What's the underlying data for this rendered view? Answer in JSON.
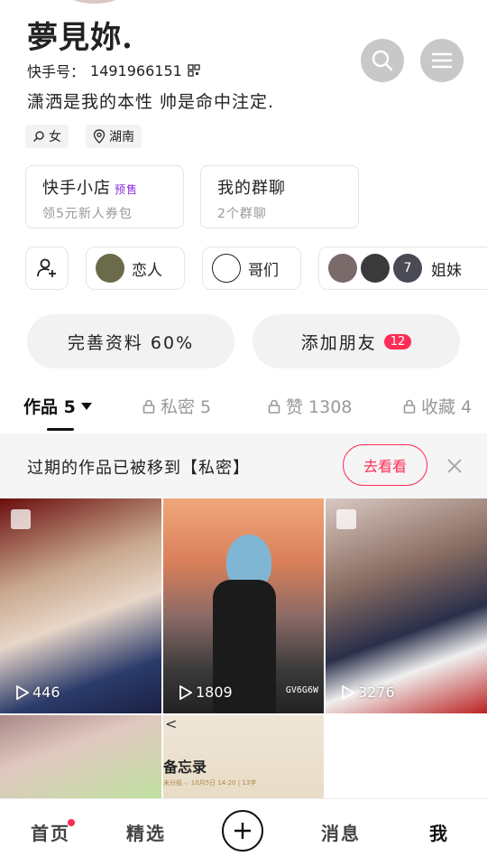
{
  "profile": {
    "name": "夢見妳.",
    "id_label": "快手号：",
    "id_value": "1491966151",
    "bio": "潇洒是我的本性 帅是命中注定.",
    "tags": [
      {
        "icon": "gender-female-icon",
        "label": "女"
      },
      {
        "icon": "location-pin-icon",
        "label": "湖南"
      }
    ]
  },
  "header": {
    "search_icon": "search-icon",
    "menu_icon": "menu-icon"
  },
  "cards": [
    {
      "title": "快手小店",
      "badge": "预售",
      "subtitle": "领5元新人券包"
    },
    {
      "title": "我的群聊",
      "subtitle": "2个群聊"
    }
  ],
  "relations": [
    {
      "label": "恋人"
    },
    {
      "label": "哥们"
    },
    {
      "label": "姐妹",
      "count": "7"
    }
  ],
  "actions": {
    "complete_profile": "完善资料 60%",
    "add_friends": "添加朋友",
    "add_friends_badge": "12"
  },
  "tabs": [
    {
      "label": "作品 5",
      "active": true
    },
    {
      "label": "私密 5"
    },
    {
      "label": "赞 1308"
    },
    {
      "label": "收藏 4"
    }
  ],
  "notice": {
    "text": "过期的作品已被移到【私密】",
    "button": "去看看"
  },
  "grid": [
    {
      "plays": "446",
      "type": "album"
    },
    {
      "plays": "1809",
      "watermark": "GV6G6W"
    },
    {
      "plays": "3276",
      "type": "album"
    },
    {},
    {
      "caption": "备忘录",
      "sub": "未分组 ⌵  10月5日 14:20 | 13字"
    }
  ],
  "nav": {
    "home": "首页",
    "featured": "精选",
    "messages": "消息",
    "me": "我"
  },
  "colors": {
    "accent": "#ff2d55",
    "presale": "#8a2be2"
  }
}
